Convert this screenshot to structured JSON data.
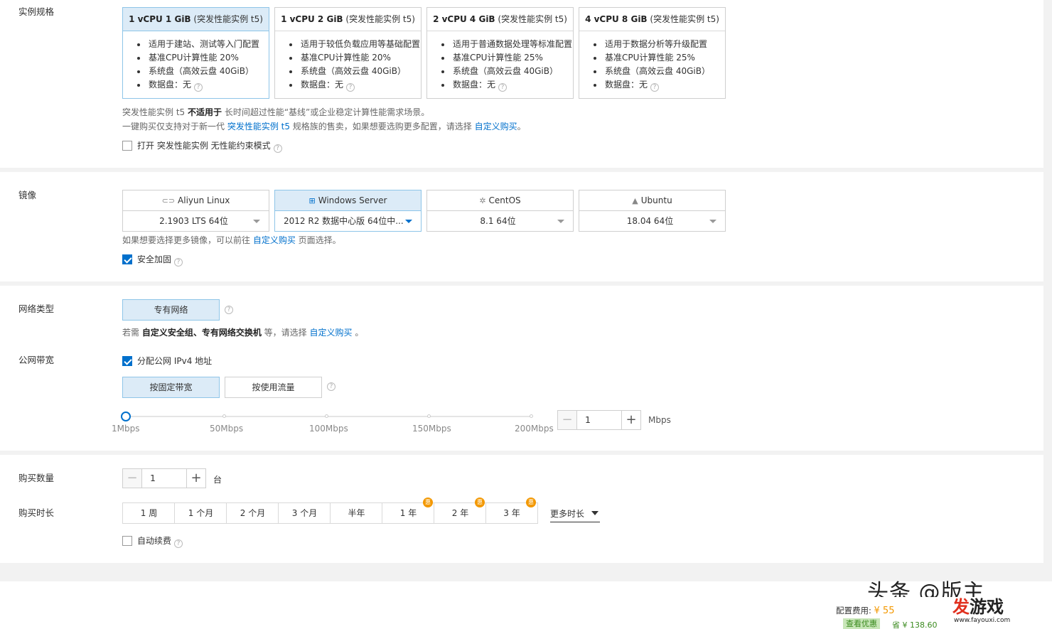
{
  "instance": {
    "label": "实例规格",
    "cards": [
      {
        "spec": "1 vCPU 1 GiB",
        "family": "(突发性能实例 t5)",
        "features": [
          "适用于建站、测试等入门配置",
          "基准CPU计算性能 20%",
          "系统盘（高效云盘 40GiB）",
          "数据盘：无"
        ],
        "selected": true
      },
      {
        "spec": "1 vCPU 2 GiB",
        "family": "(突发性能实例 t5)",
        "features": [
          "适用于较低负载应用等基础配置",
          "基准CPU计算性能 20%",
          "系统盘（高效云盘 40GiB）",
          "数据盘：无"
        ],
        "selected": false
      },
      {
        "spec": "2 vCPU 4 GiB",
        "family": "(突发性能实例 t5)",
        "features": [
          "适用于普通数据处理等标准配置",
          "基准CPU计算性能 25%",
          "系统盘（高效云盘 40GiB）",
          "数据盘：无"
        ],
        "selected": false
      },
      {
        "spec": "4 vCPU 8 GiB",
        "family": "(突发性能实例 t5)",
        "features": [
          "适用于数据分析等升级配置",
          "基准CPU计算性能 25%",
          "系统盘（高效云盘 40GiB）",
          "数据盘：无"
        ],
        "selected": false
      }
    ],
    "note1_a": "突发性能实例 t5 ",
    "note1_b": "不适用于",
    "note1_c": " 长时间超过性能“基线”或企业稳定计算性能需求场景。",
    "note2_a": "一键购买仅支持对于新一代 ",
    "note2_link": "突发性能实例 t5",
    "note2_b": " 规格族的售卖，如果想要选购更多配置，请选择 ",
    "note2_link2": "自定义购买",
    "note2_c": "。",
    "unlimited_label": "打开 突发性能实例 无性能约束模式",
    "unlimited_checked": false
  },
  "image": {
    "label": "镜像",
    "options": [
      {
        "name": "Aliyun Linux",
        "icon": "aliyun-linux-icon",
        "glyph": "⊂⊃",
        "version": "2.1903 LTS 64位",
        "selected": false
      },
      {
        "name": "Windows Server",
        "icon": "windows-icon",
        "glyph": "⊞",
        "version": "2012 R2 数据中心版 64位中...",
        "selected": true
      },
      {
        "name": "CentOS",
        "icon": "centos-icon",
        "glyph": "✲",
        "version": "8.1 64位",
        "selected": false
      },
      {
        "name": "Ubuntu",
        "icon": "ubuntu-icon",
        "glyph": "▲",
        "version": "18.04 64位",
        "selected": false
      }
    ],
    "note_a": "如果想要选择更多镜像，可以前往 ",
    "note_link": "自定义购买",
    "note_b": " 页面选择。",
    "security_label": "安全加固",
    "security_checked": true
  },
  "network": {
    "label": "网络类型",
    "type_button": "专有网络",
    "note_a": "若需 ",
    "note_b": "自定义安全组、专有网络交换机",
    "note_c": " 等，请选择 ",
    "note_link": "自定义购买",
    "note_d": " 。"
  },
  "bandwidth": {
    "label": "公网带宽",
    "ipv4_label": "分配公网 IPv4 地址",
    "ipv4_checked": true,
    "mode_fixed": "按固定带宽",
    "mode_traffic": "按使用流量",
    "ticks": [
      "1Mbps",
      "50Mbps",
      "100Mbps",
      "150Mbps",
      "200Mbps"
    ],
    "value": "1",
    "unit": "Mbps"
  },
  "purchase": {
    "qty_label": "购买数量",
    "qty_value": "1",
    "qty_unit": "台",
    "duration_label": "购买时长",
    "durations": [
      {
        "label": "1 周",
        "badge": false
      },
      {
        "label": "1 个月",
        "badge": false
      },
      {
        "label": "2 个月",
        "badge": false
      },
      {
        "label": "3 个月",
        "badge": false
      },
      {
        "label": "半年",
        "badge": false
      },
      {
        "label": "1 年",
        "badge": true
      },
      {
        "label": "2 年",
        "badge": true
      },
      {
        "label": "3 年",
        "badge": true
      }
    ],
    "badge_text": "惠",
    "more_label": "更多时长",
    "auto_renew_label": "自动续费",
    "auto_renew_checked": false
  },
  "footer": {
    "fee_label": "配置费用:",
    "fee_value": "¥ 55",
    "discount_label": "查看优惠",
    "save_label": "省 ¥ 138.60",
    "watermark_text": "头条 @版主",
    "brand_a": "发",
    "brand_b": "游戏",
    "brand_url": "www.fayouxi.com"
  },
  "colors": {
    "accent": "#0070cc",
    "selected_bg": "#dcebf7",
    "badge": "#f39800",
    "brand_red": "#e0301e"
  }
}
